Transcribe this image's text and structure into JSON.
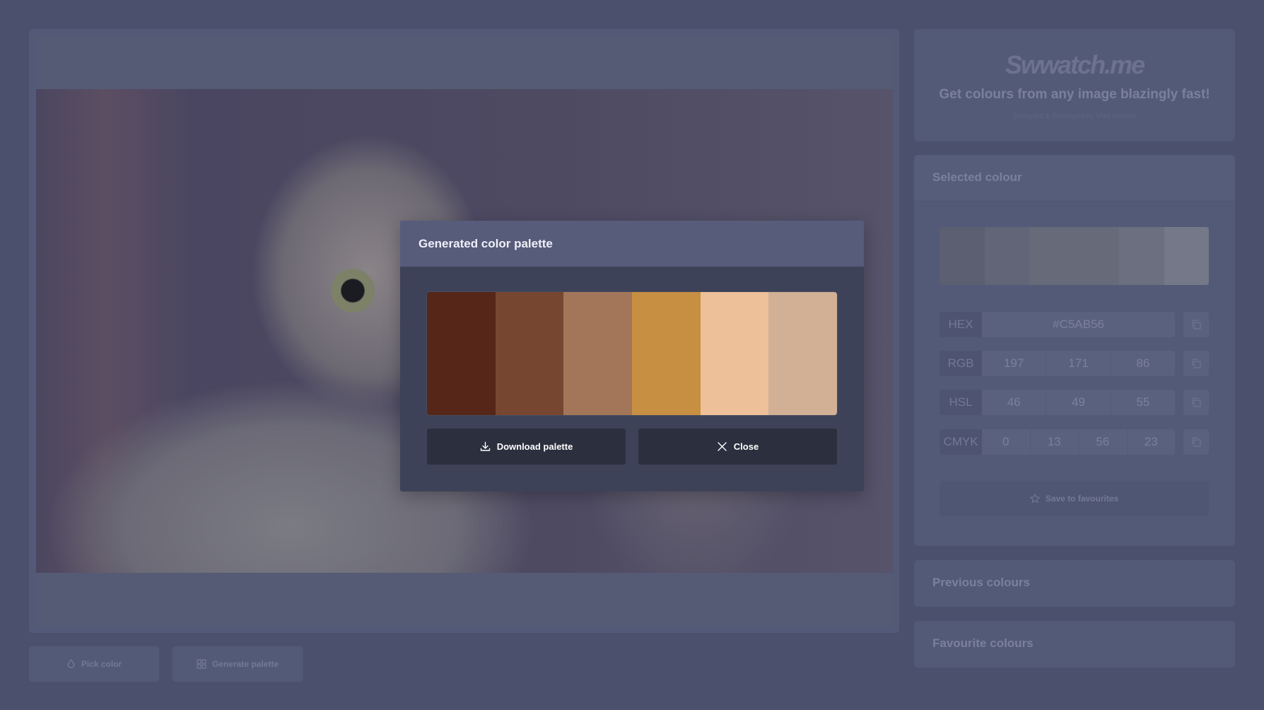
{
  "app": {
    "logo_text": "Swwatch.me",
    "tagline": "Get colours from any image blazingly fast!",
    "credit": "Designed & developed by Vlad Sidorov"
  },
  "selected": {
    "heading": "Selected colour",
    "strip_colors": [
      "#5c5f72",
      "#626577",
      "#676a79",
      "#676a79",
      "#6c6f80",
      "#757889"
    ],
    "hex_label": "HEX",
    "hex_value": "#C5AB56",
    "rgb_label": "RGB",
    "rgb": [
      "197",
      "171",
      "86"
    ],
    "hsl_label": "HSL",
    "hsl": [
      "46",
      "49",
      "55"
    ],
    "cmyk_label": "CMYK",
    "cmyk": [
      "0",
      "13",
      "56",
      "23"
    ],
    "save_label": "Save to favourites"
  },
  "previous": {
    "heading": "Previous colours"
  },
  "favourites": {
    "heading": "Favourite colours"
  },
  "toolbar": {
    "pick_label": "Pick color",
    "generate_label": "Generate palette"
  },
  "modal": {
    "title": "Generated color palette",
    "palette": [
      "#562718",
      "#774631",
      "#a3765a",
      "#c68f42",
      "#edc09a",
      "#d1b096"
    ],
    "download_label": "Download palette",
    "close_label": "Close"
  }
}
